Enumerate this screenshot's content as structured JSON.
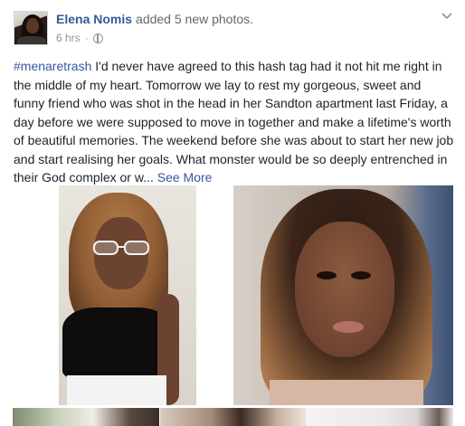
{
  "post": {
    "author": "Elena Nomis",
    "action": "added 5 new photos.",
    "time": "6 hrs",
    "separator": "·",
    "privacy_icon": "globe-icon",
    "menu_icon": "chevron-down-icon",
    "text": {
      "hashtag": "#menaretrash",
      "body": " I'd never have agreed to this hash tag had it not hit me right in the middle of my heart. Tomorrow we lay to rest my gorgeous, sweet and funny friend who was shot in the head in her Sandton apartment last Friday, a day before we were supposed to move in together and make a lifetime's worth of beautiful memories. The weekend before she was about to start her new job and start realising her goals. What monster would be so deeply entrenched in their God complex or w...",
      "see_more": "See More"
    },
    "photos_count": 5
  },
  "colors": {
    "link": "#365899",
    "text": "#1d2129",
    "meta": "#90949c"
  }
}
